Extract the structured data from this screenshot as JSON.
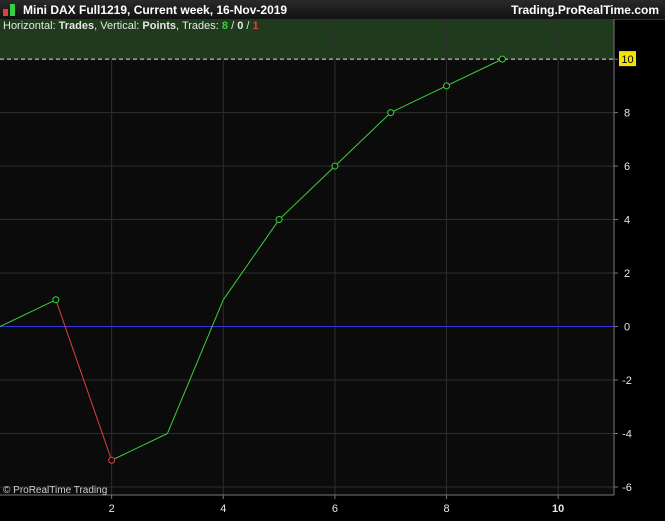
{
  "window": {
    "title": "Mini DAX Full1219, Current week, 16-Nov-2019",
    "brand": "Trading.ProRealTime.com"
  },
  "header": {
    "horizontal_label": "Horizontal:",
    "horizontal_value": "Trades",
    "vertical_label": ", Vertical:",
    "vertical_value": "Points",
    "trades_label": ", Trades:",
    "wins": "8",
    "sep1": " / ",
    "neutral": "0",
    "sep2": " / ",
    "losses": "1"
  },
  "copyright": "© ProRealTime Trading",
  "colors": {
    "background": "#0b0b0b",
    "grid": "#2e2e2e",
    "up_line": "#3ccf3c",
    "down_line": "#e0413a",
    "zero_line": "#3333dd",
    "target_band": "#1f3a1c",
    "target_line": "#d8e8d0",
    "target_badge": "#f2e600",
    "wins_text": "#3ccf3c",
    "losses_text": "#e0413a"
  },
  "chart_data": {
    "type": "line",
    "x": [
      0,
      1,
      2,
      3,
      4,
      5,
      6,
      7,
      8,
      9
    ],
    "y": [
      0,
      1,
      -5,
      -4,
      1,
      4,
      6,
      8,
      9,
      10
    ],
    "markers_at_x": [
      1,
      2,
      5,
      6,
      7,
      8,
      9
    ],
    "segment_colors": [
      "up",
      "down",
      "up",
      "up",
      "up",
      "up",
      "up",
      "up",
      "up"
    ],
    "xlim": [
      0,
      11
    ],
    "ylim": [
      -6.3,
      11.5
    ],
    "x_ticks": [
      "2",
      "4",
      "6",
      "8",
      "10"
    ],
    "y_ticks": [
      "10",
      "8",
      "6",
      "4",
      "2",
      "0",
      "-2",
      "-4",
      "-6"
    ],
    "target_value": 10,
    "zero_line": 0,
    "grid": true
  }
}
